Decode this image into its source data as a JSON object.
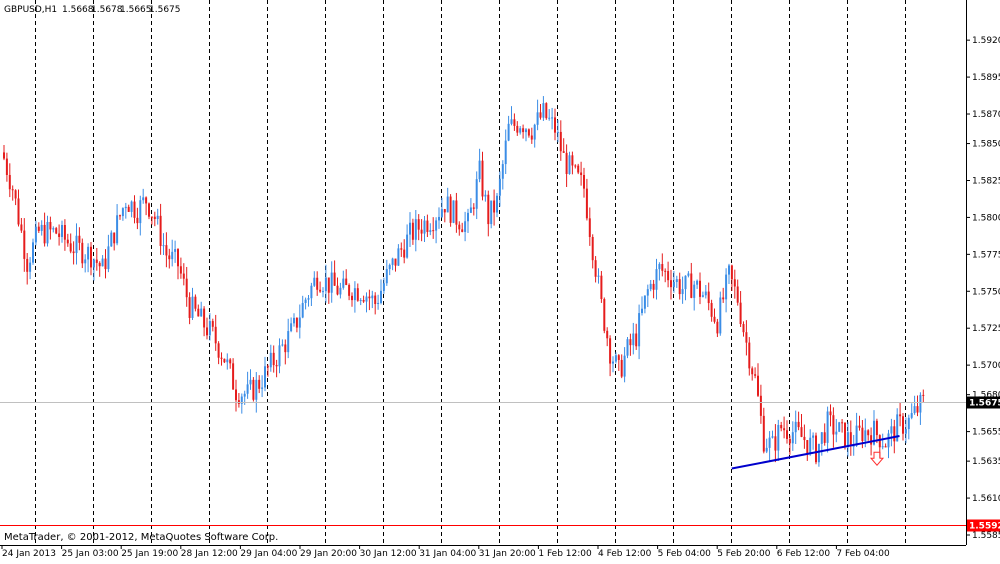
{
  "header": {
    "symbol": "GBPUSD,H1",
    "open": "1.5668",
    "high": "1.5678",
    "low": "1.5665",
    "close": "1.5675"
  },
  "footer": {
    "copyright": "MetaTrader, © 2001-2012, MetaQuotes Software Corp."
  },
  "colors": {
    "background": "#ffffff",
    "bull": "#3b8de6",
    "bear": "#e51c1c",
    "grid": "#000000",
    "trendline": "#0000cc",
    "bid_line": "#c0c0c0",
    "alert_line": "#ff0000",
    "arrow": "#ff3030"
  },
  "icons": {
    "down_arrow": "down-arrow-icon"
  },
  "chart_data": {
    "type": "candlestick",
    "symbol": "GBPUSD",
    "timeframe": "H1",
    "ylim": [
      1.5585,
      1.5935
    ],
    "y_ticks": [
      "1.5920",
      "1.5895",
      "1.5870",
      "1.5850",
      "1.5825",
      "1.5800",
      "1.5775",
      "1.5750",
      "1.5725",
      "1.5700",
      "1.5680",
      "1.5655",
      "1.5635",
      "1.5610",
      "1.5585"
    ],
    "x_tick_labels": [
      "24 Jan 2013",
      "25 Jan 03:00",
      "25 Jan 19:00",
      "28 Jan 12:00",
      "29 Jan 04:00",
      "29 Jan 20:00",
      "30 Jan 12:00",
      "31 Jan 04:00",
      "31 Jan 20:00",
      "1 Feb 12:00",
      "4 Feb 12:00",
      "5 Feb 04:00",
      "5 Feb 20:00",
      "6 Feb 12:00",
      "7 Feb 04:00"
    ],
    "current_price": "1.5675",
    "alert_price": "1.5592",
    "close_path": [
      [
        0,
        1.584
      ],
      [
        3,
        1.582
      ],
      [
        8,
        1.577
      ],
      [
        12,
        1.579
      ],
      [
        18,
        1.579
      ],
      [
        24,
        1.578
      ],
      [
        30,
        1.5775
      ],
      [
        34,
        1.5765
      ],
      [
        38,
        1.579
      ],
      [
        42,
        1.5812
      ],
      [
        46,
        1.5805
      ],
      [
        49,
        1.5812
      ],
      [
        52,
        1.58
      ],
      [
        56,
        1.5775
      ],
      [
        60,
        1.5768
      ],
      [
        64,
        1.574
      ],
      [
        68,
        1.573
      ],
      [
        72,
        1.572
      ],
      [
        76,
        1.5705
      ],
      [
        80,
        1.5683
      ],
      [
        84,
        1.568
      ],
      [
        88,
        1.5688
      ],
      [
        92,
        1.57
      ],
      [
        96,
        1.5712
      ],
      [
        100,
        1.5725
      ],
      [
        104,
        1.5745
      ],
      [
        108,
        1.576
      ],
      [
        112,
        1.5755
      ],
      [
        116,
        1.575
      ],
      [
        120,
        1.5752
      ],
      [
        124,
        1.575
      ],
      [
        128,
        1.5742
      ],
      [
        132,
        1.576
      ],
      [
        136,
        1.5775
      ],
      [
        140,
        1.5788
      ],
      [
        144,
        1.5795
      ],
      [
        148,
        1.58
      ],
      [
        152,
        1.581
      ],
      [
        156,
        1.58
      ],
      [
        160,
        1.5795
      ],
      [
        164,
        1.583
      ],
      [
        167,
        1.58
      ],
      [
        170,
        1.581
      ],
      [
        174,
        1.586
      ],
      [
        178,
        1.5865
      ],
      [
        182,
        1.586
      ],
      [
        186,
        1.587
      ],
      [
        190,
        1.586
      ],
      [
        193,
        1.584
      ],
      [
        196,
        1.583
      ],
      [
        200,
        1.582
      ],
      [
        203,
        1.578
      ],
      [
        206,
        1.574
      ],
      [
        209,
        1.571
      ],
      [
        212,
        1.5695
      ],
      [
        215,
        1.571
      ],
      [
        218,
        1.572
      ],
      [
        222,
        1.575
      ],
      [
        226,
        1.5765
      ],
      [
        230,
        1.576
      ],
      [
        234,
        1.5752
      ],
      [
        238,
        1.5755
      ],
      [
        242,
        1.5745
      ],
      [
        246,
        1.573
      ],
      [
        250,
        1.576
      ],
      [
        253,
        1.5745
      ],
      [
        256,
        1.5715
      ],
      [
        259,
        1.569
      ],
      [
        262,
        1.565
      ],
      [
        265,
        1.5645
      ],
      [
        268,
        1.5658
      ],
      [
        272,
        1.5655
      ],
      [
        276,
        1.565
      ],
      [
        280,
        1.5642
      ],
      [
        284,
        1.566
      ],
      [
        288,
        1.5655
      ],
      [
        292,
        1.5648
      ],
      [
        296,
        1.5655
      ],
      [
        300,
        1.5655
      ],
      [
        304,
        1.5648
      ],
      [
        308,
        1.5658
      ],
      [
        312,
        1.5662
      ],
      [
        315,
        1.567
      ],
      [
        317,
        1.5675
      ]
    ],
    "vertical_grid_x": [
      4,
      24,
      44,
      64,
      84,
      104,
      124,
      144,
      164,
      184,
      204,
      224,
      244,
      264,
      284,
      304
    ],
    "trendline": [
      [
        272,
        1.563
      ],
      [
        335,
        1.5652
      ]
    ],
    "annotations": [
      {
        "type": "down-arrow",
        "x": 329,
        "y": 1.5637
      }
    ]
  }
}
